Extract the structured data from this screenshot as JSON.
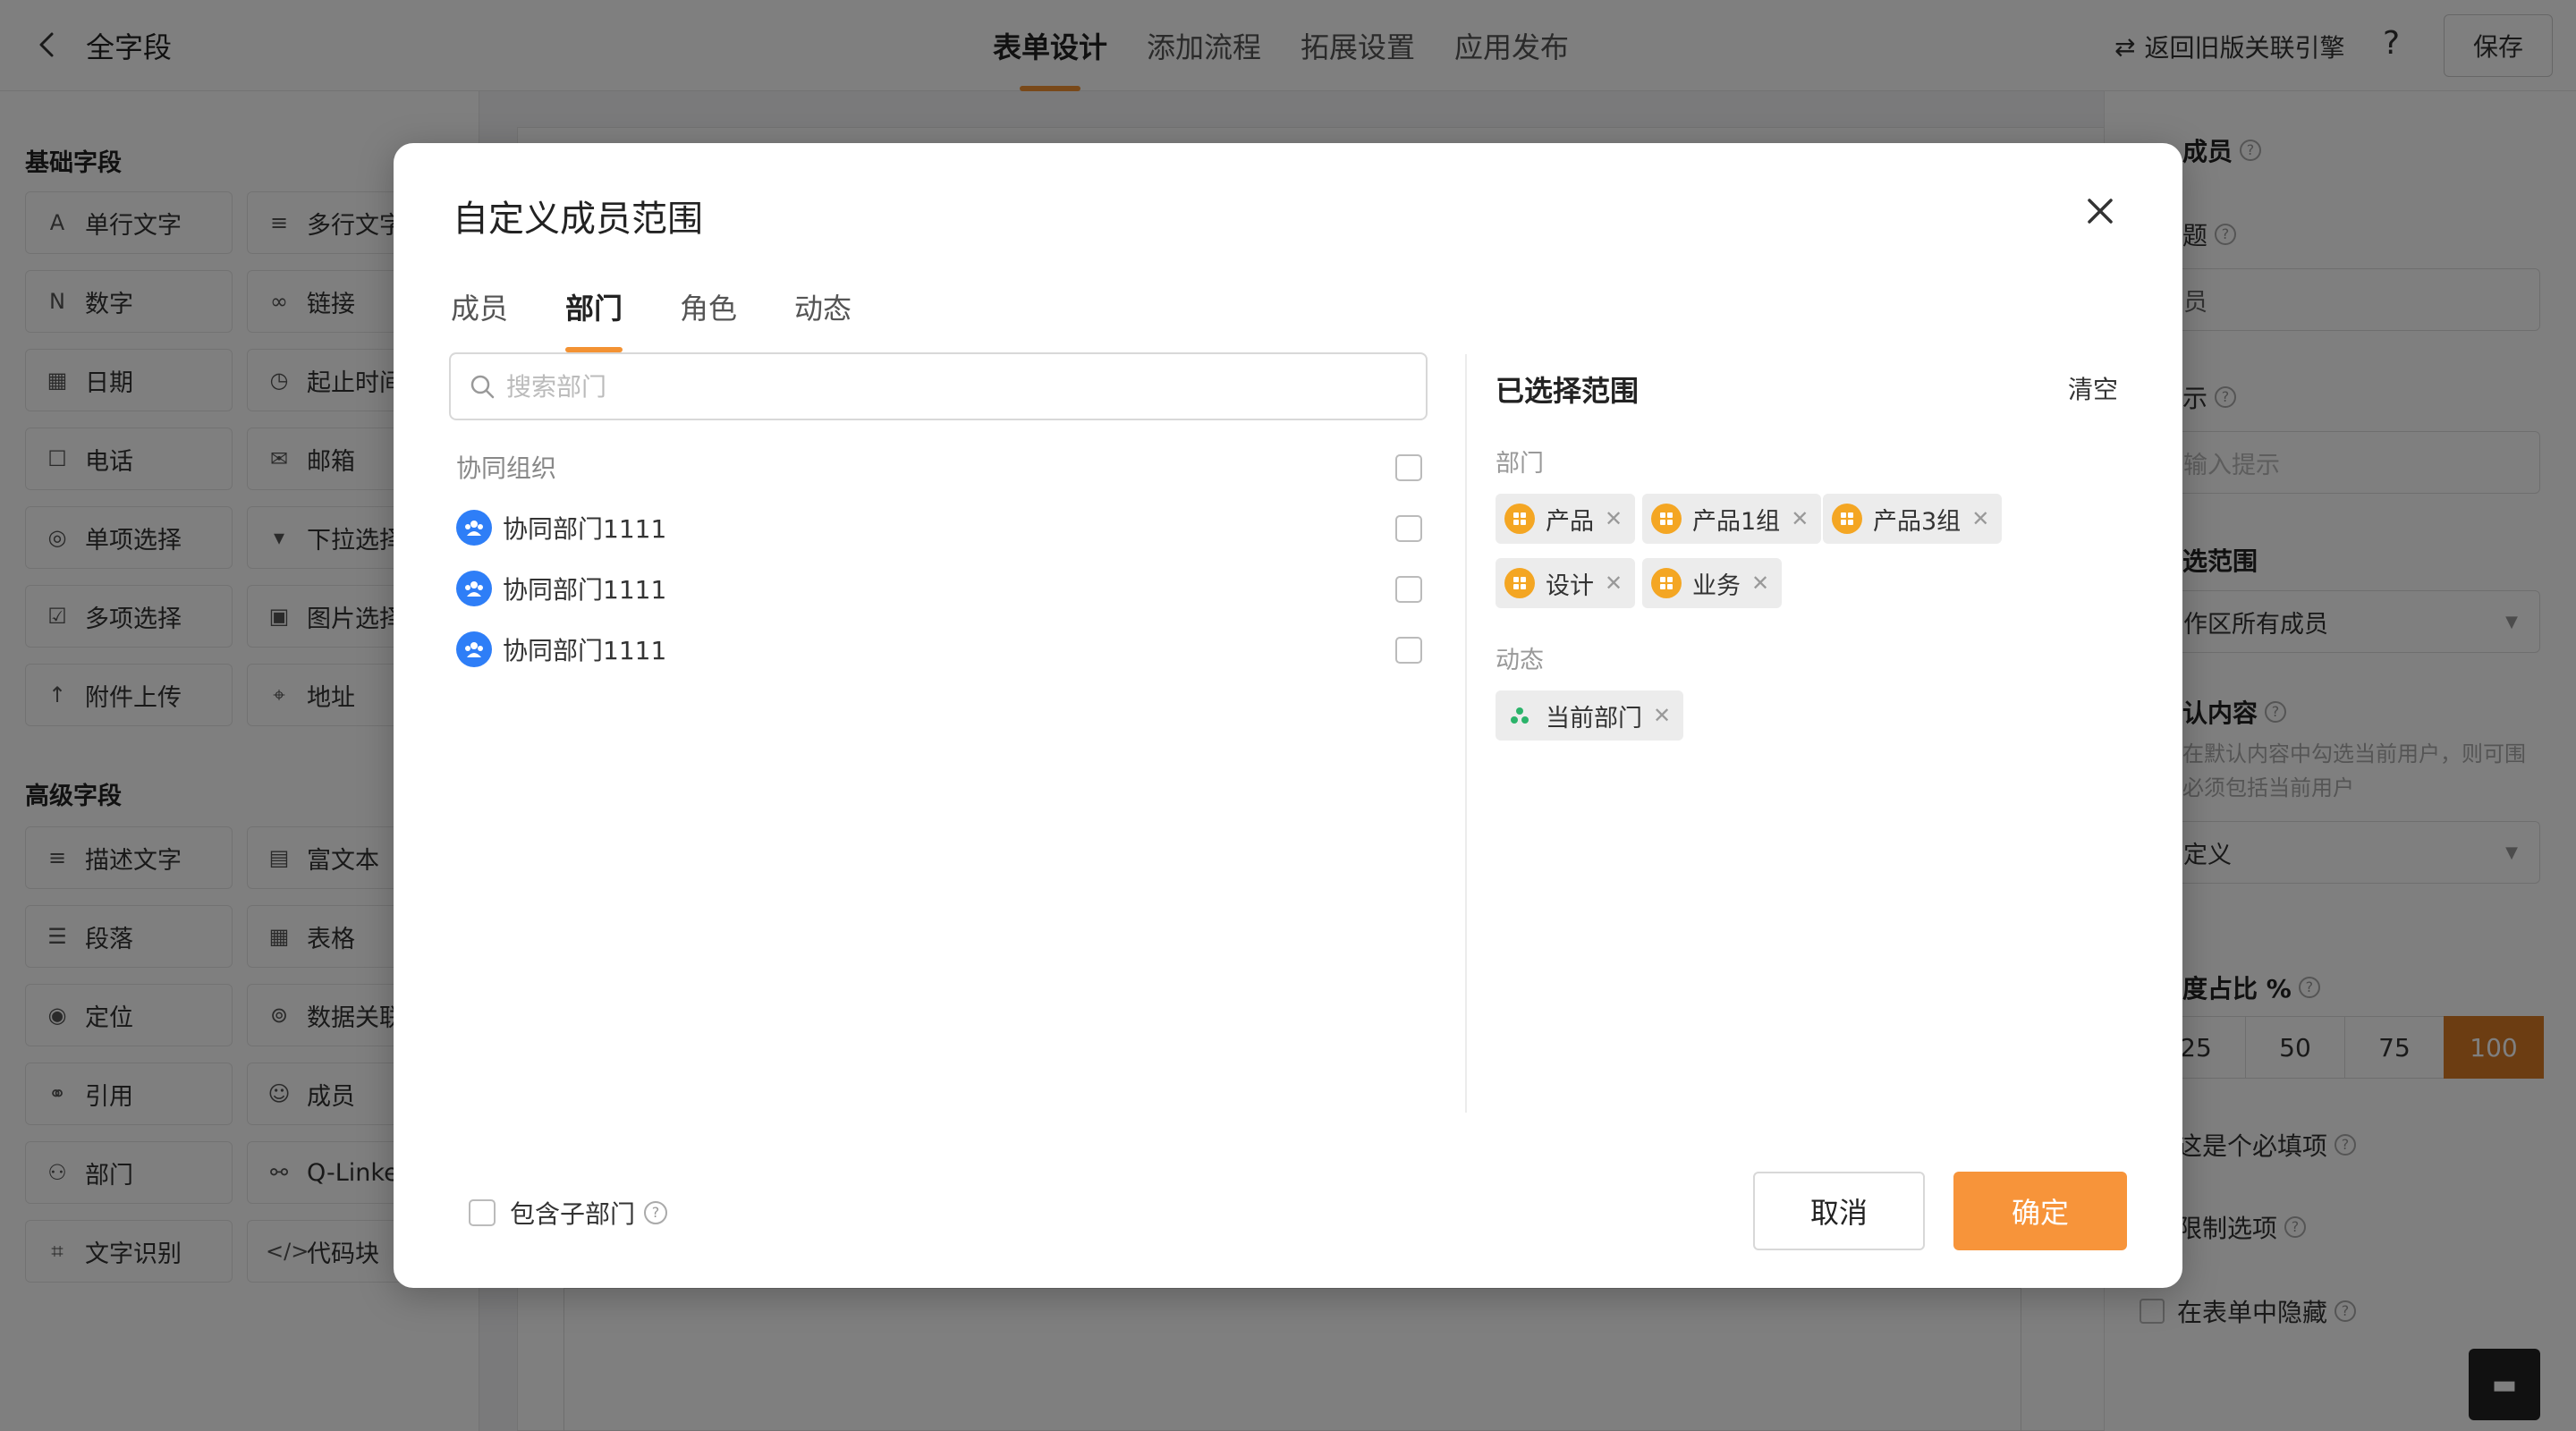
{
  "topbar": {
    "title": "全字段",
    "tabs": [
      "表单设计",
      "添加流程",
      "拓展设置",
      "应用发布"
    ],
    "engine_link": "返回旧版关联引擎",
    "help": "?",
    "save_label": "保存"
  },
  "left_panel": {
    "basic_title": "基础字段",
    "basic_fields": [
      {
        "label": "单行文字",
        "icon": "A"
      },
      {
        "label": "多行文字",
        "icon": "≡"
      },
      {
        "label": "数字",
        "icon": "N"
      },
      {
        "label": "链接",
        "icon": "∞"
      },
      {
        "label": "日期",
        "icon": "▦"
      },
      {
        "label": "起止时间",
        "icon": "◷"
      },
      {
        "label": "电话",
        "icon": "☐"
      },
      {
        "label": "邮箱",
        "icon": "✉"
      },
      {
        "label": "单项选择",
        "icon": "◎"
      },
      {
        "label": "下拉选择",
        "icon": "▾"
      },
      {
        "label": "多项选择",
        "icon": "☑"
      },
      {
        "label": "图片选择",
        "icon": "▣"
      },
      {
        "label": "附件上传",
        "icon": "↑"
      },
      {
        "label": "地址",
        "icon": "⌖"
      }
    ],
    "advanced_title": "高级字段",
    "advanced_fields": [
      {
        "label": "描述文字",
        "icon": "≡"
      },
      {
        "label": "富文本",
        "icon": "▤"
      },
      {
        "label": "段落",
        "icon": "☰"
      },
      {
        "label": "表格",
        "icon": "▦"
      },
      {
        "label": "定位",
        "icon": "◉"
      },
      {
        "label": "数据关联",
        "icon": "⊚"
      },
      {
        "label": "引用",
        "icon": "⚭"
      },
      {
        "label": "成员",
        "icon": "☺"
      },
      {
        "label": "部门",
        "icon": "⚇"
      },
      {
        "label": "Q-Linker",
        "icon": "⚯"
      },
      {
        "label": "文字识别",
        "icon": "⌗"
      },
      {
        "label": "代码块",
        "icon": "</>"
      }
    ]
  },
  "right_panel": {
    "title": "成员",
    "field2_label": "题",
    "field2_value": "员",
    "field3_label": "示",
    "field3_placeholder": "输入提示",
    "scope_label": "选范围",
    "scope_value": "作区所有成员",
    "default_label": "认内容",
    "default_hint": "在默认内容中勾选当前用户，则可围必须包括当前用户",
    "default_value": "定义",
    "width_label": "度占比 %",
    "width_options": [
      "25",
      "50",
      "75",
      "100"
    ],
    "width_active": "100",
    "required_label": "这是个必填项",
    "limit_label": "限制选项",
    "hide_label": "在表单中隐藏"
  },
  "dialog": {
    "title": "自定义成员范围",
    "tabs": [
      "成员",
      "部门",
      "角色",
      "动态"
    ],
    "active_tab": "部门",
    "search_placeholder": "搜索部门",
    "tree": [
      {
        "label": "协同组织",
        "type": "group"
      },
      {
        "label": "协同部门1111",
        "type": "dept"
      },
      {
        "label": "协同部门1111",
        "type": "dept"
      },
      {
        "label": "协同部门1111",
        "type": "dept"
      }
    ],
    "selected_title": "已选择范围",
    "clear_label": "清空",
    "dept_group_label": "部门",
    "dept_tags": [
      "产品",
      "产品1组",
      "产品3组",
      "设计",
      "业务"
    ],
    "dyn_group_label": "动态",
    "dyn_tags": [
      "当前部门"
    ],
    "include_sub_label": "包含子部门",
    "cancel_label": "取消",
    "ok_label": "确定"
  },
  "colors": {
    "accent": "#f7943a",
    "dept_avatar": "#2e7ef7",
    "tag_icon": "#f4a623",
    "dyn_icon": "#2bb36a"
  }
}
